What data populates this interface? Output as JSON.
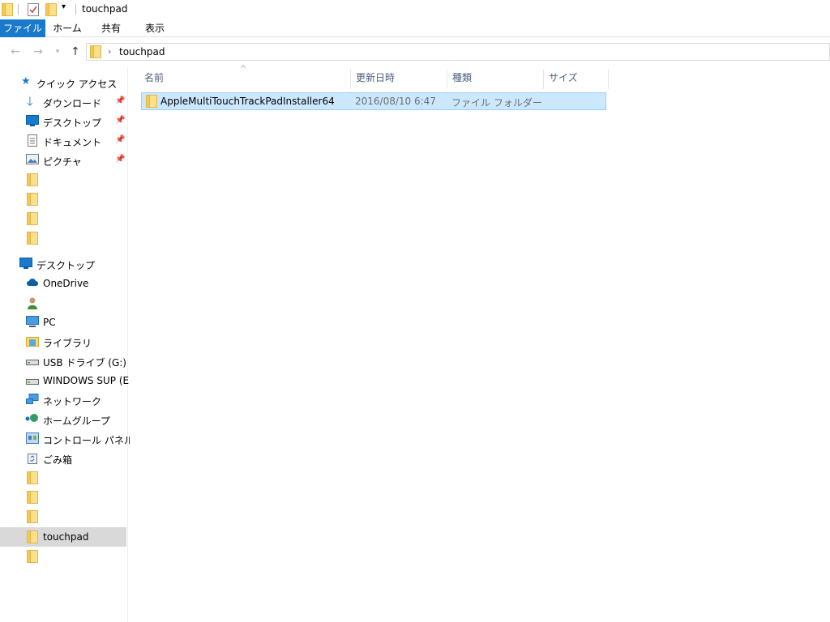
{
  "window": {
    "title": "touchpad"
  },
  "ribbon": {
    "tabs": [
      "ファイル",
      "ホーム",
      "共有",
      "表示"
    ]
  },
  "address": {
    "path": "touchpad"
  },
  "nav": {
    "quick_access": "クイック アクセス",
    "quick_items": [
      "ダウンロード",
      "デスクトップ",
      "ドキュメント",
      "ピクチャ"
    ],
    "desktop": "デスクトップ",
    "items": [
      "OneDrive",
      "PC",
      "ライブラリ",
      "USB ドライブ (G:)",
      "WINDOWS SUP (E:)",
      "ネットワーク",
      "ホームグループ",
      "コントロール パネル",
      "ごみ箱"
    ],
    "selected_folder": "touchpad"
  },
  "columns": {
    "name": "名前",
    "date": "更新日時",
    "type": "種類",
    "size": "サイズ"
  },
  "files": [
    {
      "name": "AppleMultiTouchTrackPadInstaller64",
      "date": "2016/08/10 6:47",
      "type": "ファイル フォルダー",
      "size": ""
    }
  ],
  "colors": {
    "accent": "#1979ca",
    "selection": "#cce8ff",
    "folder": "#ffd867"
  }
}
